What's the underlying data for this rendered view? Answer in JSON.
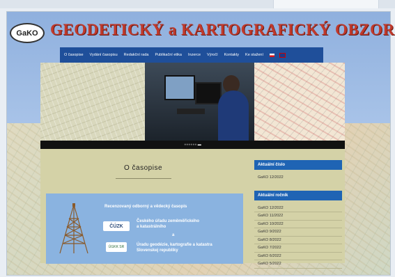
{
  "site": {
    "logo_text": "GaKO",
    "title": "GEODETICKÝ a KARTOGRAFICKÝ OBZOR"
  },
  "nav": {
    "items": [
      {
        "label": "O časopise"
      },
      {
        "label": "Vydání časopisu"
      },
      {
        "label": "Redakční rada"
      },
      {
        "label": "Publikační etika"
      },
      {
        "label": "Inzerce"
      },
      {
        "label": "Výročí"
      },
      {
        "label": "Kontakty"
      },
      {
        "label": "Ke stažení"
      }
    ]
  },
  "main": {
    "heading": "O časopise",
    "card": {
      "line1": "Recenzovaný odborný a vědecký časopis",
      "line2": "Českého úřadu zeměměřického",
      "line3": "a katastrálního",
      "line4": "a",
      "line5": "Úradu geodézie, kartografie a katastra",
      "line6": "Slovenskej republiky",
      "cuzk_logo": "ČÚZK",
      "gkk_logo": "ÚGKK SR"
    }
  },
  "sidebar": {
    "current_issue_title": "Aktuální číslo",
    "current_issue": "GaKO 12/2022",
    "current_volume_title": "Aktuální ročník",
    "volume_items": [
      "GaKO 12/2022",
      "GaKO 11/2022",
      "GaKO 10/2022",
      "GaKO 9/2022",
      "GaKO 8/2022",
      "GaKO 7/2022",
      "GaKO 6/2022",
      "GaKO 5/2022"
    ]
  },
  "colors": {
    "title_red": "#c0392b",
    "nav_blue": "#1f4f9a",
    "sidebar_head": "#1f64b4",
    "content_bg": "#d4d2a7",
    "card_bg": "#8ab3e0"
  }
}
